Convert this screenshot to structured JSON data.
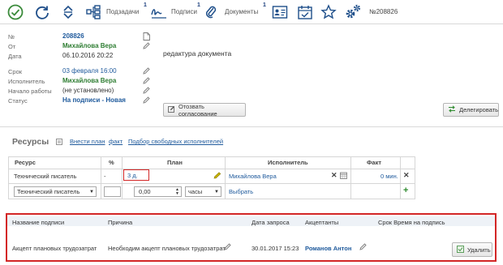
{
  "toolbar": {
    "tabs": [
      {
        "label": "Подзадачи",
        "badge": "1"
      },
      {
        "label": "Подписи",
        "badge": "1"
      },
      {
        "label": "Документы",
        "badge": "1"
      }
    ],
    "doc_number": "№208826"
  },
  "info": {
    "rows": [
      {
        "label": "№",
        "value": "208826"
      },
      {
        "label": "От",
        "value": "Михайлова Вера"
      },
      {
        "label": "Дата",
        "value": "06.10.2016 20:22"
      },
      {
        "label": "Срок",
        "value": "03 февраля 16:00"
      },
      {
        "label": "Исполнитель",
        "value": "Михайлова Вера"
      },
      {
        "label": "Начало работы",
        "value": "(не установлено)"
      },
      {
        "label": "Статус",
        "value": "На подписи - Новая"
      }
    ],
    "description": "редактура документа"
  },
  "buttons": {
    "revoke": "Отозвать согласование",
    "delegate": "Делегировать",
    "delete": "Удалить"
  },
  "resources": {
    "title": "Ресурсы",
    "links": [
      "Внести план",
      "факт",
      "Подбор свободных исполнителей"
    ],
    "columns": [
      "Ресурс",
      "%",
      "План",
      "Исполнитель",
      "Факт"
    ],
    "row": {
      "resource": "Технический писатель",
      "percent": "-",
      "plan": "3 д.",
      "executor": "Михайлова Вера",
      "fact": "0 мин."
    },
    "new_row": {
      "resource": "Технический писатель",
      "amount": "0,00",
      "unit": "часы",
      "choose": "Выбрать"
    }
  },
  "approvals": {
    "columns": [
      "Название подписи",
      "Причина",
      "Дата запроса",
      "Акцептанты",
      "Срок Время на подпись"
    ],
    "row": {
      "name": "Акцепт плановых трудозатрат",
      "reason": "Необходим акцепт плановых трудозатрат",
      "date": "30.01.2017 15:23",
      "acceptor": "Романов Антон"
    }
  },
  "colors": {
    "accent_blue": "#1f5a9c",
    "green": "#2e7d32",
    "highlight_red": "#d32626"
  }
}
